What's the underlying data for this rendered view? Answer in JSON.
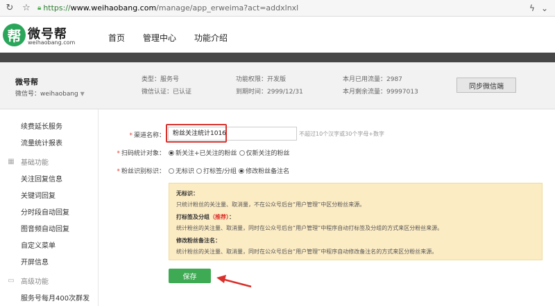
{
  "browser": {
    "url_https": "https://",
    "url_host": "www.weihaobang.com",
    "url_path": "/manage/app_erweima?act=addxlnxl"
  },
  "site": {
    "logo_glyph": "帮",
    "logo_name": "微号帮",
    "logo_domain": "weihaobang.com",
    "nav": [
      "首页",
      "管理中心",
      "功能介绍"
    ],
    "brand_color": "#2aa65a"
  },
  "account": {
    "name": "微号帮",
    "wechat_label": "微信号：weihaobang",
    "type": "类型：服务号",
    "certified": "微信认证：已认证",
    "permission": "功能权限：开发版",
    "expire": "到期时间：2999/12/31",
    "used_traffic": "本月已用流量：2987",
    "remaining_traffic": "本月剩余流量：99997013",
    "sync_button": "同步微信端"
  },
  "sidebar": {
    "items_top": [
      "续费延长服务",
      "流量统计报表"
    ],
    "section_basic": "基础功能",
    "items_basic": [
      "关注回复信息",
      "关键词回复",
      "分时段自动回复",
      "图音频自动回复",
      "自定义菜单",
      "开屏信息"
    ],
    "section_advanced": "高级功能",
    "items_advanced": [
      "服务号每月400次群发"
    ]
  },
  "form": {
    "channel_label": "渠道名称：",
    "channel_value": "粉丝关注统计1016",
    "channel_hint": "不超过10个汉字或30个字母+数字",
    "scan_label": "扫码统计对象：",
    "scan_options": [
      "新关注+已关注的粉丝",
      "仅新关注的粉丝"
    ],
    "tag_label": "粉丝识别标识：",
    "tag_options": [
      "无标识",
      "打标签/分组",
      "修改粉丝备注名"
    ],
    "info": {
      "t1": "无标识：",
      "d1": "只统计粉丝的关注量、取消量，不在公众号后台“用户管理”中区分粉丝来源。",
      "t2": "打标签及分组",
      "t2_rec": "（推荐）",
      "t2_colon": "：",
      "d2": "统计粉丝的关注量、取消量，同时在公众号后台“用户管理”中程序自动打标签及分组的方式来区分粉丝来源。",
      "t3": "修改粉丝备注名：",
      "d3": "统计粉丝的关注量、取消量，同时在公众号后台“用户管理”中程序自动修改备注名的方式来区分粉丝来源。"
    },
    "save_button": "保存"
  }
}
